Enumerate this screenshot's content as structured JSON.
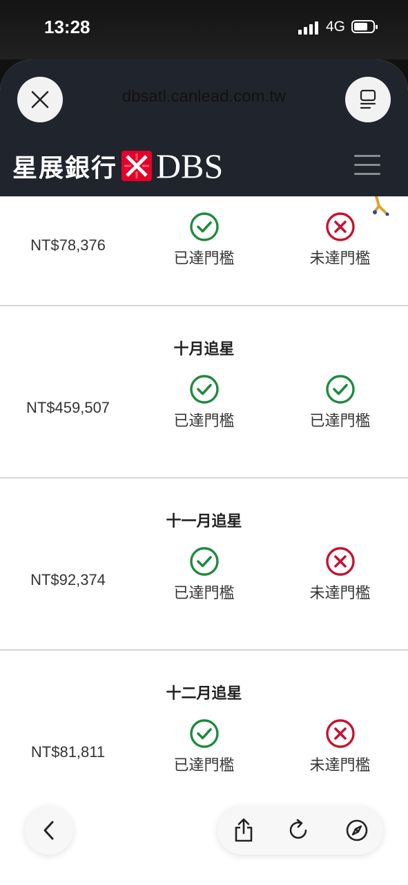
{
  "status_bar": {
    "time": "13:28",
    "network": "4G"
  },
  "browser": {
    "url": "dbsatl.canlead.com.tw"
  },
  "site": {
    "logo_cn": "星展銀行",
    "logo_en": "DBS"
  },
  "rows": [
    {
      "title": "",
      "amount": "NT$78,376",
      "status1": "已達門檻",
      "status2": "未達門檻",
      "status1_met": true,
      "status2_met": false
    },
    {
      "title": "十月追星",
      "amount": "NT$459,507",
      "status1": "已達門檻",
      "status2": "已達門檻",
      "status1_met": true,
      "status2_met": true
    },
    {
      "title": "十一月追星",
      "amount": "NT$92,374",
      "status1": "已達門檻",
      "status2": "未達門檻",
      "status1_met": true,
      "status2_met": false
    },
    {
      "title": "十二月追星",
      "amount": "NT$81,811",
      "status1": "已達門檻",
      "status2": "未達門檻",
      "status1_met": true,
      "status2_met": false
    }
  ],
  "colors": {
    "met": "#1e8a3e",
    "not_met": "#c8102e",
    "header": "#20252d"
  },
  "icons": [
    "close-icon",
    "reader-icon",
    "menu-icon",
    "check-circle-icon",
    "x-circle-icon",
    "back-chevron-icon",
    "share-icon",
    "reload-icon",
    "compass-icon"
  ]
}
